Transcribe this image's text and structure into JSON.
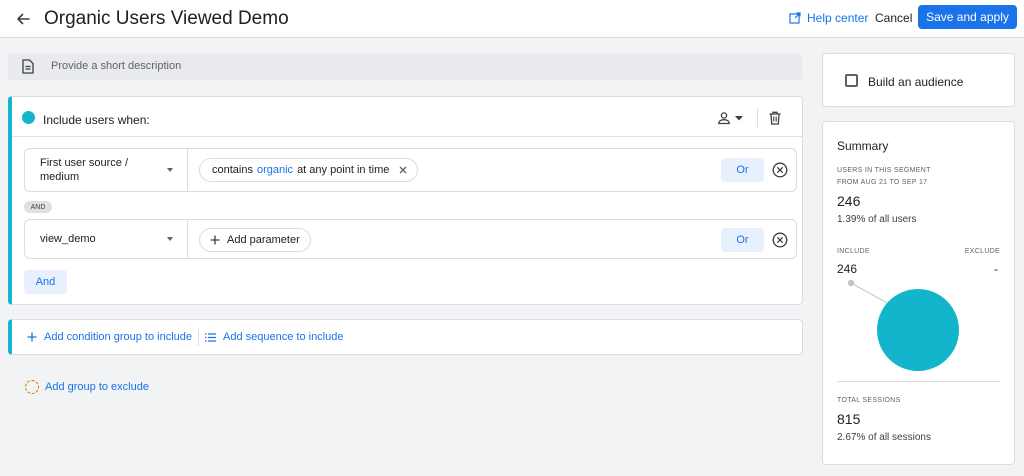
{
  "header": {
    "title": "Organic Users Viewed Demo",
    "help_label": "Help center",
    "cancel_label": "Cancel",
    "apply_label": "Save and apply"
  },
  "description": {
    "placeholder": "Provide a short description"
  },
  "include": {
    "heading": "Include users when:",
    "conditions": [
      {
        "field_line1": "First user source /",
        "field_line2": "medium",
        "chip_pre": "contains",
        "chip_value": "organic",
        "chip_post": "at any point in time",
        "or_label": "Or"
      },
      {
        "field_line1": "view_demo",
        "chip_pre": "Add parameter",
        "or_label": "Or"
      }
    ],
    "and_badge": "AND",
    "and_button": "And"
  },
  "adders": {
    "condition_group": "Add condition group to include",
    "sequence": "Add sequence to include",
    "exclude_group": "Add group to exclude"
  },
  "audience": {
    "label": "Build an audience"
  },
  "summary": {
    "title": "Summary",
    "users_caption_1": "USERS IN THIS SEGMENT",
    "users_caption_2": "FROM AUG 21 TO SEP 17",
    "users_value": "246",
    "users_pct": "1.39% of all users",
    "include_caption": "INCLUDE",
    "exclude_caption": "EXCLUDE",
    "include_value": "246",
    "exclude_value": "-",
    "sessions_caption": "TOTAL SESSIONS",
    "sessions_value": "815",
    "sessions_pct": "2.67% of all sessions",
    "pie_include_fraction": 1.0
  },
  "colors": {
    "accent": "#1a73e8",
    "teal": "#12b5cb",
    "orange": "#e37400"
  }
}
